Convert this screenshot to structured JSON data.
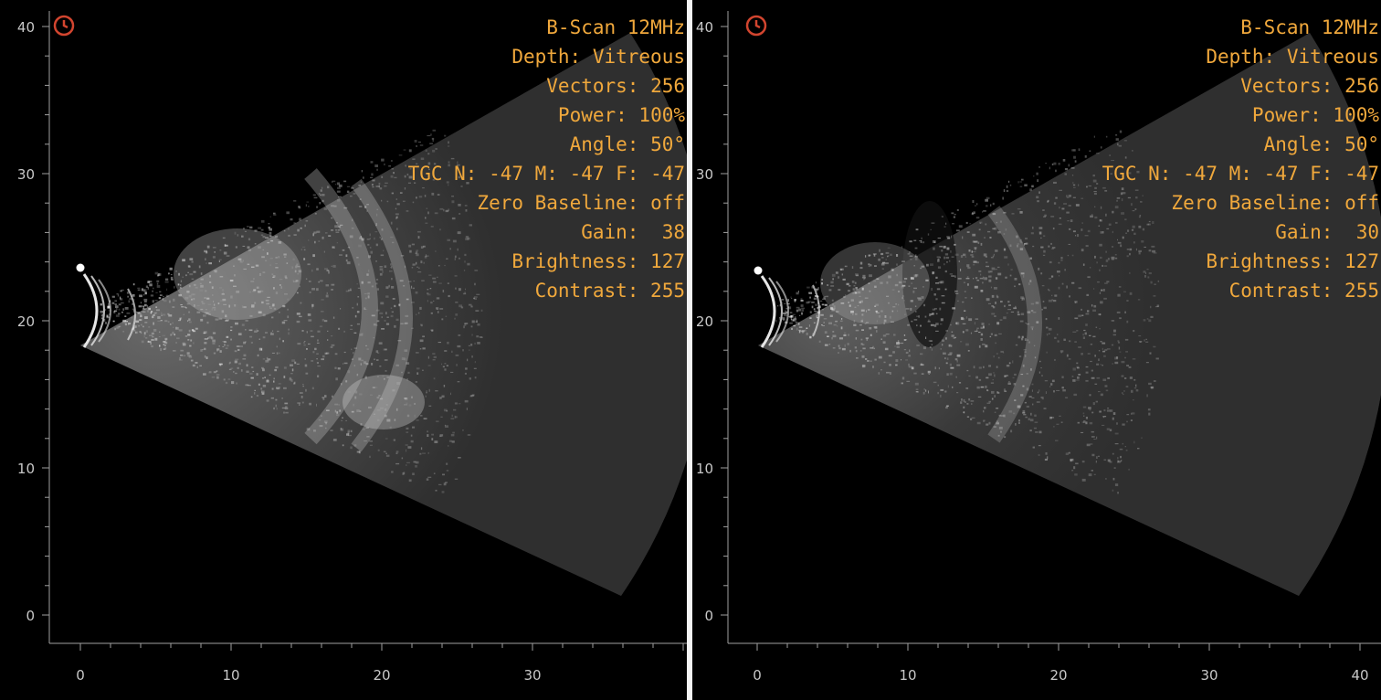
{
  "colors": {
    "overlay_text": "#f0a83c",
    "clock_icon": "#d2452f",
    "axis": "#a0a0a0",
    "sector_fill": "#2f2f2f"
  },
  "panels": [
    {
      "id": "left",
      "overlay": [
        "B-Scan 12MHz",
        "Depth: Vitreous",
        "Vectors: 256",
        "Power: 100%",
        "Angle: 50°",
        "TGC N: -47 M: -47 F: -47",
        "Zero Baseline: off",
        "Gain:  38",
        "Brightness: 127",
        "Contrast: 255"
      ],
      "x_ticks": [
        "0",
        "10",
        "20",
        "30"
      ],
      "y_ticks": [
        "0",
        "10",
        "20",
        "30",
        "40"
      ],
      "x_range": [
        0,
        40
      ],
      "y_range": [
        0,
        40
      ],
      "icons": [
        "clock-icon",
        "probe-marker-dot"
      ]
    },
    {
      "id": "right",
      "overlay": [
        "B-Scan 12MHz",
        "Depth: Vitreous",
        "Vectors: 256",
        "Power: 100%",
        "Angle: 50°",
        "TGC N: -47 M: -47 F: -47",
        "Zero Baseline: off",
        "Gain:  30",
        "Brightness: 127",
        "Contrast: 255"
      ],
      "x_ticks": [
        "0",
        "10",
        "20",
        "30",
        "40"
      ],
      "y_ticks": [
        "0",
        "10",
        "20",
        "30",
        "40"
      ],
      "x_range": [
        0,
        40
      ],
      "y_range": [
        0,
        40
      ],
      "icons": [
        "clock-icon",
        "probe-marker-dot"
      ]
    }
  ]
}
